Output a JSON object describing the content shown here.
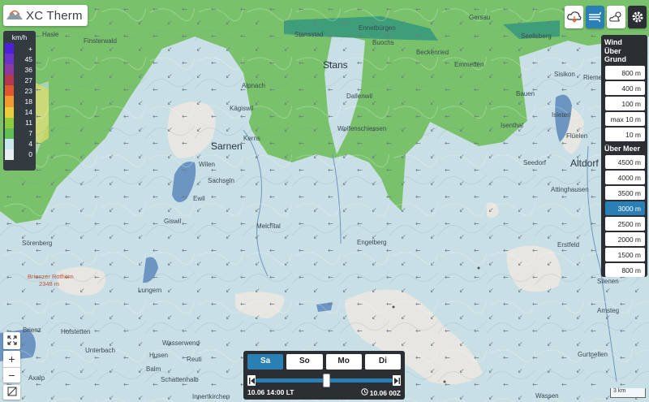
{
  "app": {
    "title": "XC Therm"
  },
  "legend": {
    "unit": "km/h",
    "levels": [
      {
        "label": "+",
        "color": "#4b20d8"
      },
      {
        "label": "45",
        "color": "#6a32c8"
      },
      {
        "label": "36",
        "color": "#8c3aa0"
      },
      {
        "label": "27",
        "color": "#b3384e"
      },
      {
        "label": "23",
        "color": "#e0562f"
      },
      {
        "label": "18",
        "color": "#f39a2e"
      },
      {
        "label": "14",
        "color": "#e9cd3a"
      },
      {
        "label": "11",
        "color": "#8dcc3d"
      },
      {
        "label": "7",
        "color": "#5fbf55"
      },
      {
        "label": "4",
        "color": "#c9e6ef"
      },
      {
        "label": "0",
        "color": "#e8eef0"
      }
    ]
  },
  "wind_panel": {
    "ground_header": "Wind",
    "ground_subheader": "Über Grund",
    "ground_levels": [
      "800 m",
      "400 m",
      "100 m",
      "max 10 m",
      "10 m"
    ],
    "sea_header": "Über Meer",
    "sea_levels": [
      "4500 m",
      "4000 m",
      "3500 m",
      "3000 m",
      "2500 m",
      "2000 m",
      "1500 m",
      "800 m"
    ],
    "selected_level": "3000 m"
  },
  "time_panel": {
    "days": [
      "Sa",
      "So",
      "Mo",
      "Di"
    ],
    "selected_day": "Sa",
    "slider_position": 0.52,
    "local_time": "10.06 14:00 LT",
    "model_run": "10.06 00Z"
  },
  "scale": {
    "label": "3 km"
  },
  "places": [
    {
      "name": "Hasle",
      "big": false
    },
    {
      "name": "Finsterwald",
      "big": false
    },
    {
      "name": "Stansstad",
      "big": false
    },
    {
      "name": "Ennetbürgen",
      "big": false
    },
    {
      "name": "Gersau",
      "big": false
    },
    {
      "name": "Buochs",
      "big": false
    },
    {
      "name": "Seelisberg",
      "big": false
    },
    {
      "name": "Stans",
      "big": true
    },
    {
      "name": "Beckenried",
      "big": false
    },
    {
      "name": "Emmetten",
      "big": false
    },
    {
      "name": "Alpnach",
      "big": false
    },
    {
      "name": "Kägiswil",
      "big": false
    },
    {
      "name": "Dallenwil",
      "big": false
    },
    {
      "name": "Bauen",
      "big": false
    },
    {
      "name": "Sisikon",
      "big": false
    },
    {
      "name": "Riemen",
      "big": false
    },
    {
      "name": "Isleten",
      "big": false
    },
    {
      "name": "Flüelen",
      "big": false
    },
    {
      "name": "Isenthal",
      "big": false
    },
    {
      "name": "Wolfenschiessen",
      "big": false
    },
    {
      "name": "Kerns",
      "big": false
    },
    {
      "name": "Sarnen",
      "big": true
    },
    {
      "name": "Wilen",
      "big": false
    },
    {
      "name": "Sachseln",
      "big": false
    },
    {
      "name": "Ewil",
      "big": false
    },
    {
      "name": "Seedorf",
      "big": false
    },
    {
      "name": "Altdorf",
      "big": true
    },
    {
      "name": "Attinghausen",
      "big": false
    },
    {
      "name": "Giswil",
      "big": false
    },
    {
      "name": "Melchtal",
      "big": false
    },
    {
      "name": "Engelberg",
      "big": false
    },
    {
      "name": "Erstfeld",
      "big": false
    },
    {
      "name": "Sörenberg",
      "big": false
    },
    {
      "name": "Lungern",
      "big": false
    },
    {
      "name": "Silenen",
      "big": false
    },
    {
      "name": "Amsteg",
      "big": false
    },
    {
      "name": "Brienz",
      "big": false
    },
    {
      "name": "Hofstetten",
      "big": false
    },
    {
      "name": "Wasserwend",
      "big": false
    },
    {
      "name": "Unterbach",
      "big": false
    },
    {
      "name": "Husen",
      "big": false
    },
    {
      "name": "Reuti",
      "big": false
    },
    {
      "name": "Gurtnellen",
      "big": false
    },
    {
      "name": "Balm",
      "big": false
    },
    {
      "name": "Schattenhalb",
      "big": false
    },
    {
      "name": "Axalp",
      "big": false
    },
    {
      "name": "Innertkirchen",
      "big": false
    },
    {
      "name": "Wassen",
      "big": false
    }
  ],
  "peak": {
    "name": "Brienzer Rothorn",
    "elevation": "2348 m"
  }
}
